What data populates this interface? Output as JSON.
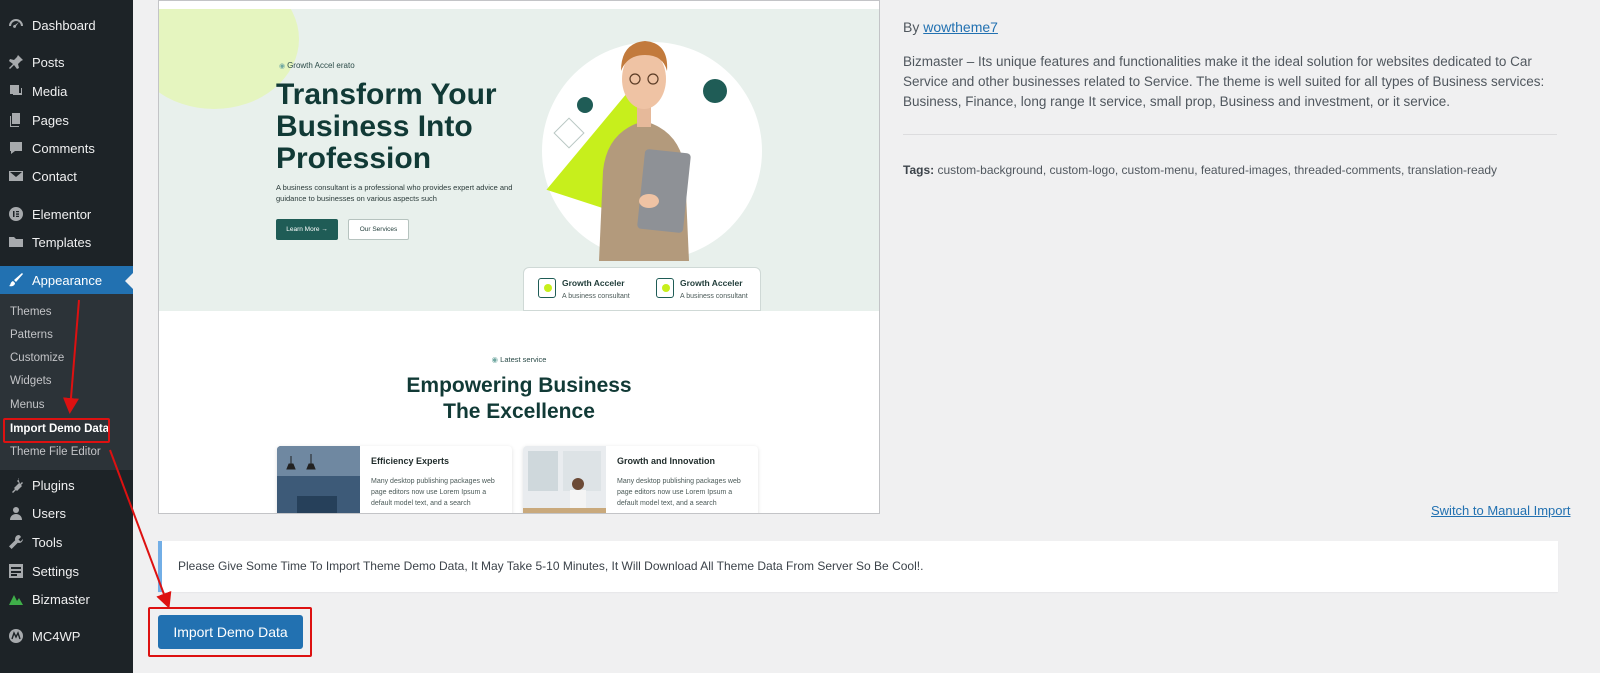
{
  "sidebar": {
    "items": [
      {
        "label": "Dashboard",
        "icon": "dashboard-icon"
      },
      {
        "label": "Posts",
        "icon": "pin-icon"
      },
      {
        "label": "Media",
        "icon": "media-icon"
      },
      {
        "label": "Pages",
        "icon": "pages-icon"
      },
      {
        "label": "Comments",
        "icon": "comment-icon"
      },
      {
        "label": "Contact",
        "icon": "mail-icon"
      },
      {
        "label": "Elementor",
        "icon": "elementor-icon"
      },
      {
        "label": "Templates",
        "icon": "folder-icon"
      },
      {
        "label": "Appearance",
        "icon": "brush-icon"
      },
      {
        "label": "Plugins",
        "icon": "plugin-icon"
      },
      {
        "label": "Users",
        "icon": "user-icon"
      },
      {
        "label": "Tools",
        "icon": "wrench-icon"
      },
      {
        "label": "Settings",
        "icon": "settings-icon"
      },
      {
        "label": "Bizmaster",
        "icon": "bizmaster-icon"
      },
      {
        "label": "MC4WP",
        "icon": "mc4wp-icon"
      }
    ],
    "submenu": [
      "Themes",
      "Patterns",
      "Customize",
      "Widgets",
      "Menus",
      "Import Demo Data",
      "Theme File Editor"
    ]
  },
  "preview": {
    "hero": {
      "tagline": "Growth Accel erato",
      "headline": "Transform Your Business Into Profession",
      "description": "A business consultant is a professional who provides expert advice and guidance to businesses on various aspects such",
      "btn_primary": "Learn More →",
      "btn_secondary": "Our Services",
      "stats": [
        {
          "title": "Growth Acceler",
          "desc": "A business consultant"
        },
        {
          "title": "Growth Acceler",
          "desc": "A business consultant"
        }
      ]
    },
    "services": {
      "tag": "Latest service",
      "title_line1": "Empowering Business",
      "title_line2": "The Excellence",
      "cards": [
        {
          "title": "Efficiency Experts",
          "desc": "Many desktop publishing packages web page editors now use Lorem Ipsum a default model text, and a search"
        },
        {
          "title": "Growth and Innovation",
          "desc": "Many desktop publishing packages web page editors now use Lorem Ipsum a default model text, and a search"
        }
      ]
    },
    "colors": {
      "accent": "#c7ef1c",
      "dark_green": "#1f5c56",
      "hero_bg": "#e8f0ec"
    }
  },
  "theme": {
    "by_label": "By",
    "author": "wowtheme7",
    "description": "Bizmaster – Its unique features and functionalities make it the ideal solution for websites dedicated to Car Service and other businesses related to Service. The theme is well suited for all types of Business services: Business, Finance, long range It service, small prop, Business and investment, or it service.",
    "tags_label": "Tags:",
    "tags": "custom-background, custom-logo, custom-menu, featured-images, threaded-comments, translation-ready"
  },
  "manual_link": "Switch to Manual Import",
  "notice": "Please Give Some Time To Import Theme Demo Data, It May Take 5-10 Minutes, It Will Download All Theme Data From Server So Be Cool!.",
  "import_button": "Import Demo Data",
  "colors": {
    "wp_blue": "#2271b1",
    "sidebar_bg": "#1d2327",
    "annotation_red": "#dd1111"
  }
}
